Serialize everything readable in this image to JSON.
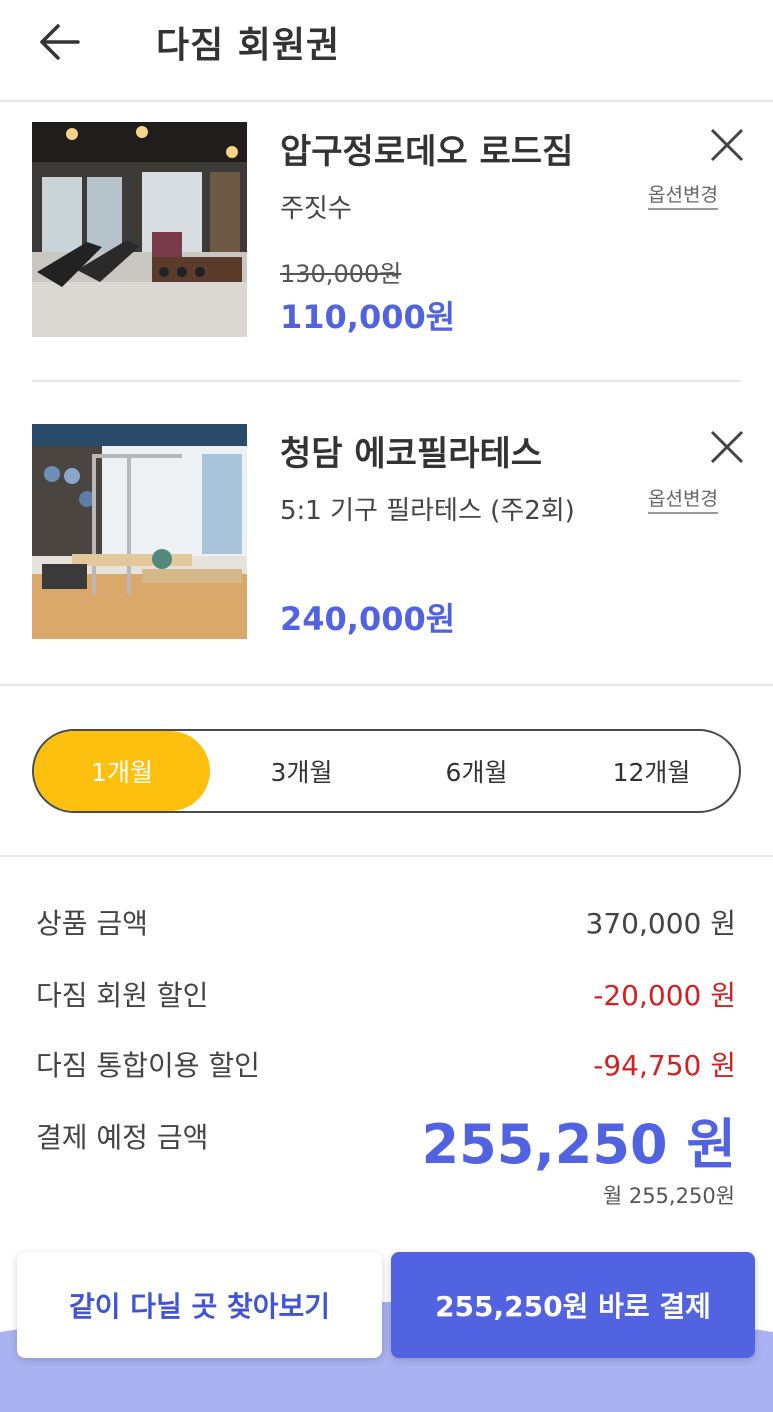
{
  "header": {
    "title": "다짐 회원권",
    "back_icon": "arrow-left-icon"
  },
  "cart_items": [
    {
      "name": "압구정로데오 로드짐",
      "option": "주짓수",
      "original_price": "130,000원",
      "price": "110,000원",
      "option_change_label": "옵션변경",
      "image": "gym-interior-treadmills"
    },
    {
      "name": "청담 에코필라테스",
      "option": "5:1 기구 필라테스 (주2회)",
      "original_price": "",
      "price": "240,000원",
      "option_change_label": "옵션변경",
      "image": "pilates-studio-reformers"
    }
  ],
  "period": {
    "options": [
      "1개월",
      "3개월",
      "6개월",
      "12개월"
    ],
    "selected": "1개월"
  },
  "summary": {
    "product_amount_label": "상품 금액",
    "product_amount_value": "370,000 원",
    "member_discount_label": "다짐 회원 할인",
    "member_discount_value": "-20,000 원",
    "integrated_discount_label": "다짐 통합이용 할인",
    "integrated_discount_value": "-94,750 원",
    "total_label": "결제 예정 금액",
    "total_value": "255,250 원",
    "monthly_value": "월 255,250원"
  },
  "buttons": {
    "explore_label": "같이 다닐 곳 찾아보기",
    "pay_label": "255,250원 바로 결제"
  },
  "colors": {
    "accent_blue": "#5163e0",
    "selected_yellow": "#fdc00f",
    "discount_red": "#d32121",
    "wave_lavender": "#aab2f2"
  }
}
